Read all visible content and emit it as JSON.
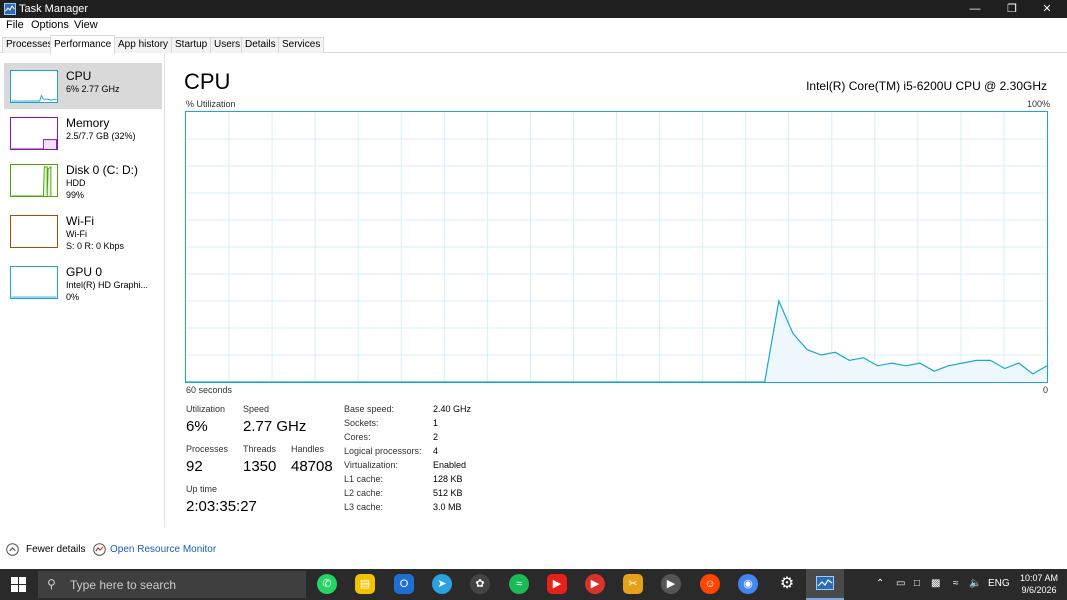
{
  "window": {
    "title": "Task Manager"
  },
  "menu": [
    "File",
    "Options",
    "View"
  ],
  "tabs": [
    "Processes",
    "Performance",
    "App history",
    "Startup",
    "Users",
    "Details",
    "Services"
  ],
  "active_tab": "Performance",
  "sidebar": {
    "items": [
      {
        "name": "CPU",
        "lines": [
          "6% 2.77 GHz"
        ],
        "color": "#1ca6d4"
      },
      {
        "name": "Memory",
        "lines": [
          "2.5/7.7 GB (32%)"
        ],
        "color": "#8b12ae"
      },
      {
        "name": "Disk 0 (C: D:)",
        "lines": [
          "HDD",
          "99%"
        ],
        "color": "#4da60c"
      },
      {
        "name": "Wi-Fi",
        "lines": [
          "Wi-Fi",
          "S: 0 R: 0 Kbps"
        ],
        "color": "#a74f01"
      },
      {
        "name": "GPU 0",
        "lines": [
          "Intel(R) HD Graphi...",
          "0%"
        ],
        "color": "#1ca6d4"
      }
    ]
  },
  "main": {
    "heading": "CPU",
    "model": "Intel(R) Core(TM) i5-6200U CPU @ 2.30GHz",
    "y_label": "% Utilization",
    "y_max_label": "100%",
    "x_left_label": "60 seconds",
    "x_right_label": "0"
  },
  "stats": {
    "utilization_label": "Utilization",
    "utilization": "6%",
    "speed_label": "Speed",
    "speed": "2.77 GHz",
    "processes_label": "Processes",
    "processes": "92",
    "threads_label": "Threads",
    "threads": "1350",
    "handles_label": "Handles",
    "handles": "48708",
    "uptime_label": "Up time",
    "uptime": "2:03:35:27"
  },
  "info": [
    {
      "key": "Base speed:",
      "value": "2.40 GHz"
    },
    {
      "key": "Sockets:",
      "value": "1"
    },
    {
      "key": "Cores:",
      "value": "2"
    },
    {
      "key": "Logical processors:",
      "value": "4"
    },
    {
      "key": "Virtualization:",
      "value": "Enabled"
    },
    {
      "key": "L1 cache:",
      "value": "128 KB"
    },
    {
      "key": "L2 cache:",
      "value": "512 KB"
    },
    {
      "key": "L3 cache:",
      "value": "3.0 MB"
    }
  ],
  "footer": {
    "fewer_details": "Fewer details",
    "resource_monitor": "Open Resource Monitor"
  },
  "taskbar": {
    "search_placeholder": "Type here to search",
    "language": "ENG",
    "time": "10:07 AM",
    "date": "9/6/2026"
  },
  "cpu_history": [
    0,
    0,
    0,
    0,
    0,
    0,
    0,
    0,
    0,
    0,
    0,
    0,
    0,
    0,
    0,
    0,
    0,
    0,
    0,
    0,
    0,
    0,
    0,
    0,
    0,
    0,
    0,
    0,
    0,
    0,
    0,
    0,
    0,
    0,
    0,
    0,
    0,
    0,
    0,
    0,
    0,
    0,
    30,
    18,
    12,
    10,
    11,
    8,
    9,
    6,
    7,
    6,
    7,
    4,
    6,
    7,
    8,
    8,
    5,
    7,
    3,
    6
  ],
  "chart_data": {
    "type": "area",
    "title": "CPU",
    "xlabel": "60 seconds",
    "ylabel": "% Utilization",
    "ylim": [
      0,
      100
    ],
    "x": [
      "60 seconds",
      "0"
    ],
    "series": [
      {
        "values": [
          0,
          0,
          0,
          0,
          0,
          0,
          0,
          0,
          0,
          0,
          0,
          0,
          0,
          0,
          0,
          0,
          0,
          0,
          0,
          0,
          0,
          0,
          0,
          0,
          0,
          0,
          0,
          0,
          0,
          0,
          0,
          0,
          0,
          0,
          0,
          0,
          0,
          0,
          0,
          0,
          0,
          0,
          30,
          18,
          12,
          10,
          11,
          8,
          9,
          6,
          7,
          6,
          7,
          4,
          6,
          7,
          8,
          8,
          5,
          7,
          3,
          6
        ]
      }
    ]
  }
}
